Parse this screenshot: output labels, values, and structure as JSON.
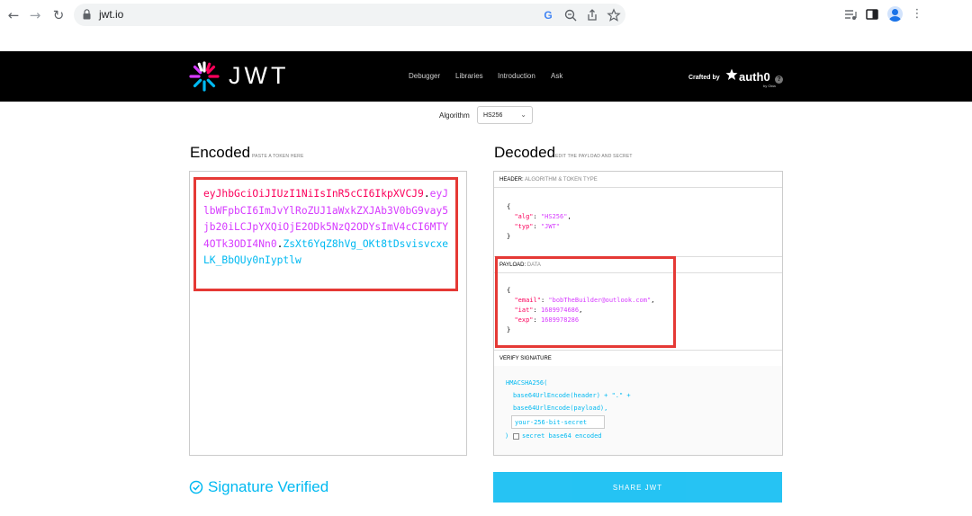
{
  "browser": {
    "url": "jwt.io",
    "back_icon": "←",
    "forward_icon": "→",
    "reload_icon": "↻"
  },
  "header": {
    "logo_text": "JWT",
    "nav": [
      "Debugger",
      "Libraries",
      "Introduction",
      "Ask"
    ],
    "crafted_by": "Crafted by",
    "brand": "auth0",
    "brand_sub": "by Okta"
  },
  "algorithm": {
    "label": "Algorithm",
    "value": "HS256"
  },
  "encoded": {
    "title": "Encoded",
    "subtitle": "PASTE A TOKEN HERE",
    "token_header": "eyJhbGciOiJIUzI1NiIsInR5cCI6IkpXVCJ9",
    "token_payload": "eyJlbWFpbCI6ImJvYlRoZUJ1aWxkZXJAb3V0bG9vay5jb20iLCJpYXQiOjE2ODk5NzQ2ODYsImV4cCI6MTY4OTk3ODI4Nn0",
    "token_signature": "ZsXt6YqZ8hVg_OKt8tDsvisvcxeLK_BbQUy0nIyptlw",
    "dot": "."
  },
  "decoded": {
    "title": "Decoded",
    "subtitle": "EDIT THE PAYLOAD AND SECRET",
    "header_section": {
      "label": "HEADER:",
      "sub": "ALGORITHM & TOKEN TYPE"
    },
    "header_json": {
      "alg_key": "\"alg\"",
      "alg_val": "\"HS256\"",
      "typ_key": "\"typ\"",
      "typ_val": "\"JWT\""
    },
    "payload_section": {
      "label": "PAYLOAD:",
      "sub": "DATA"
    },
    "payload_json": {
      "email_key": "\"email\"",
      "email_val": "\"bobTheBuilder@outlook.com\"",
      "iat_key": "\"iat\"",
      "iat_val": "1689974686",
      "exp_key": "\"exp\"",
      "exp_val": "1689978286"
    },
    "signature_section": {
      "label": "VERIFY SIGNATURE"
    },
    "signature": {
      "fn": "HMACSHA256(",
      "line1": "base64UrlEncode(header) + \".\" +",
      "line2": "base64UrlEncode(payload),",
      "secret_value": "your-256-bit-secret",
      "close": ")",
      "checkbox_label": "secret base64 encoded"
    }
  },
  "status": {
    "verified": "Signature Verified"
  },
  "share": {
    "label": "SHARE JWT"
  },
  "colors": {
    "header_red": "#fb015b",
    "payload_purple": "#d63aff",
    "signature_blue": "#00b9f1",
    "highlight": "#e53935"
  }
}
